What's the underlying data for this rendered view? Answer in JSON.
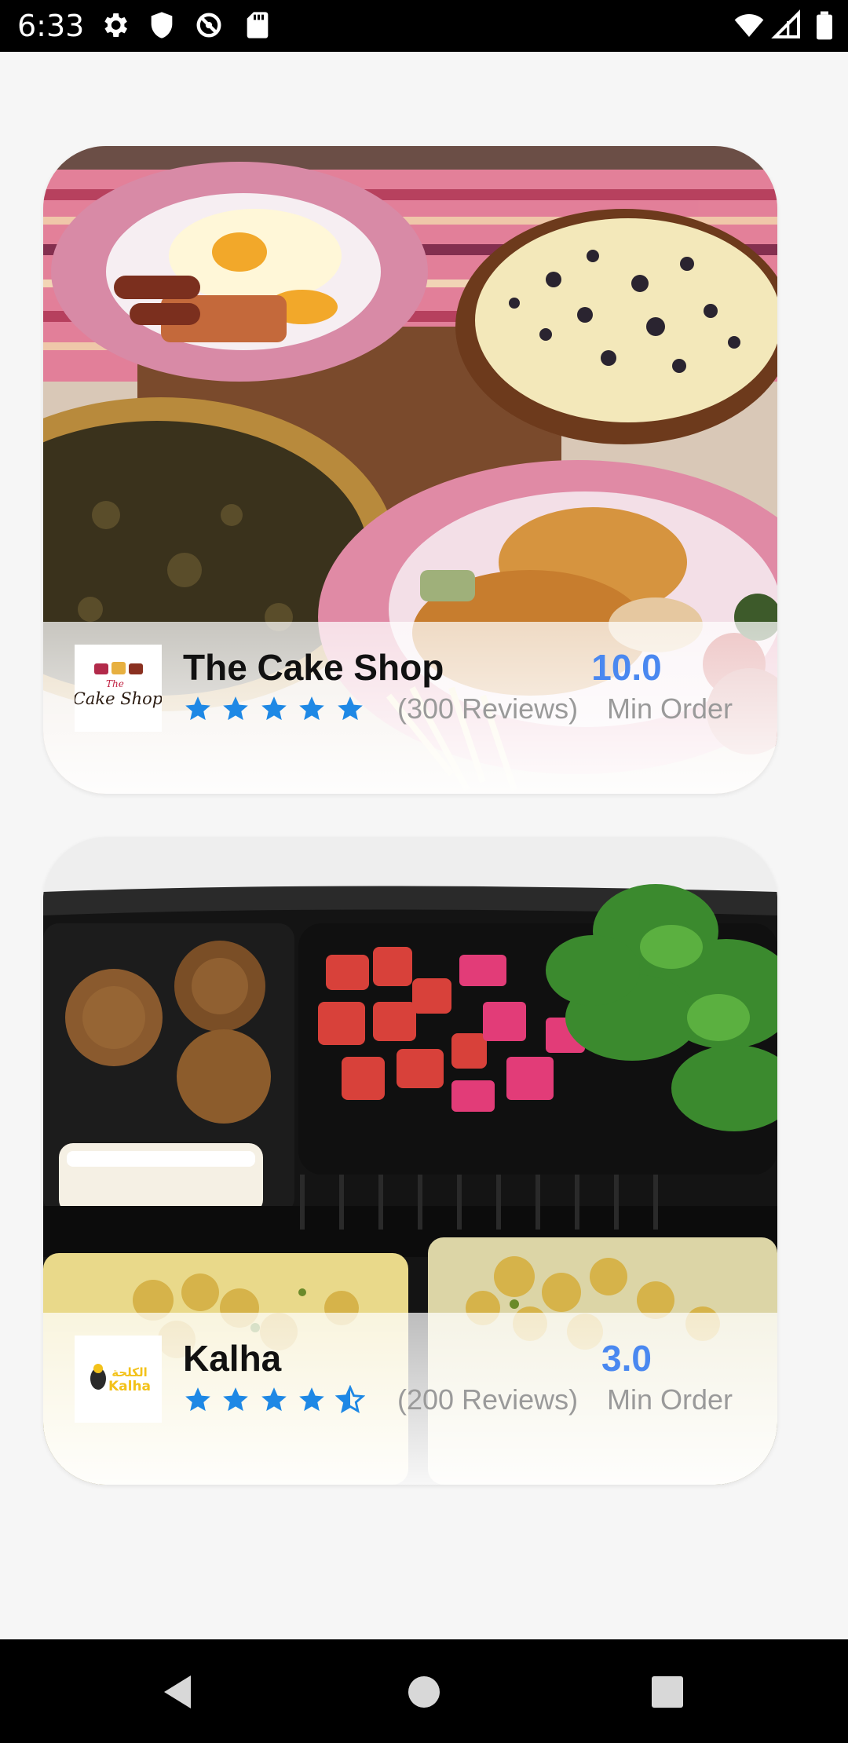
{
  "status_bar": {
    "time": "6:33",
    "icons": [
      "gear-icon",
      "shield-icon",
      "sync-off-icon",
      "sd-card-icon",
      "wifi-icon",
      "signal-icon",
      "battery-icon"
    ]
  },
  "restaurants": [
    {
      "name": "The Cake Shop",
      "logo_text": "Cake Shop",
      "rating": 5,
      "reviews": "(300 Reviews)",
      "min_order_value": "10.0",
      "min_order_label": "Min Order"
    },
    {
      "name": "Kalha",
      "logo_text": "Kalha",
      "rating": 4.5,
      "reviews": "(200 Reviews)",
      "min_order_value": "3.0",
      "min_order_label": "Min Order"
    }
  ],
  "colors": {
    "accent": "#4a88f0",
    "star": "#1e88e5",
    "muted_text": "#9a9a9a",
    "background": "#f6f6f6"
  },
  "nav_bar": {
    "buttons": [
      "back-icon",
      "home-icon",
      "recents-icon"
    ]
  }
}
